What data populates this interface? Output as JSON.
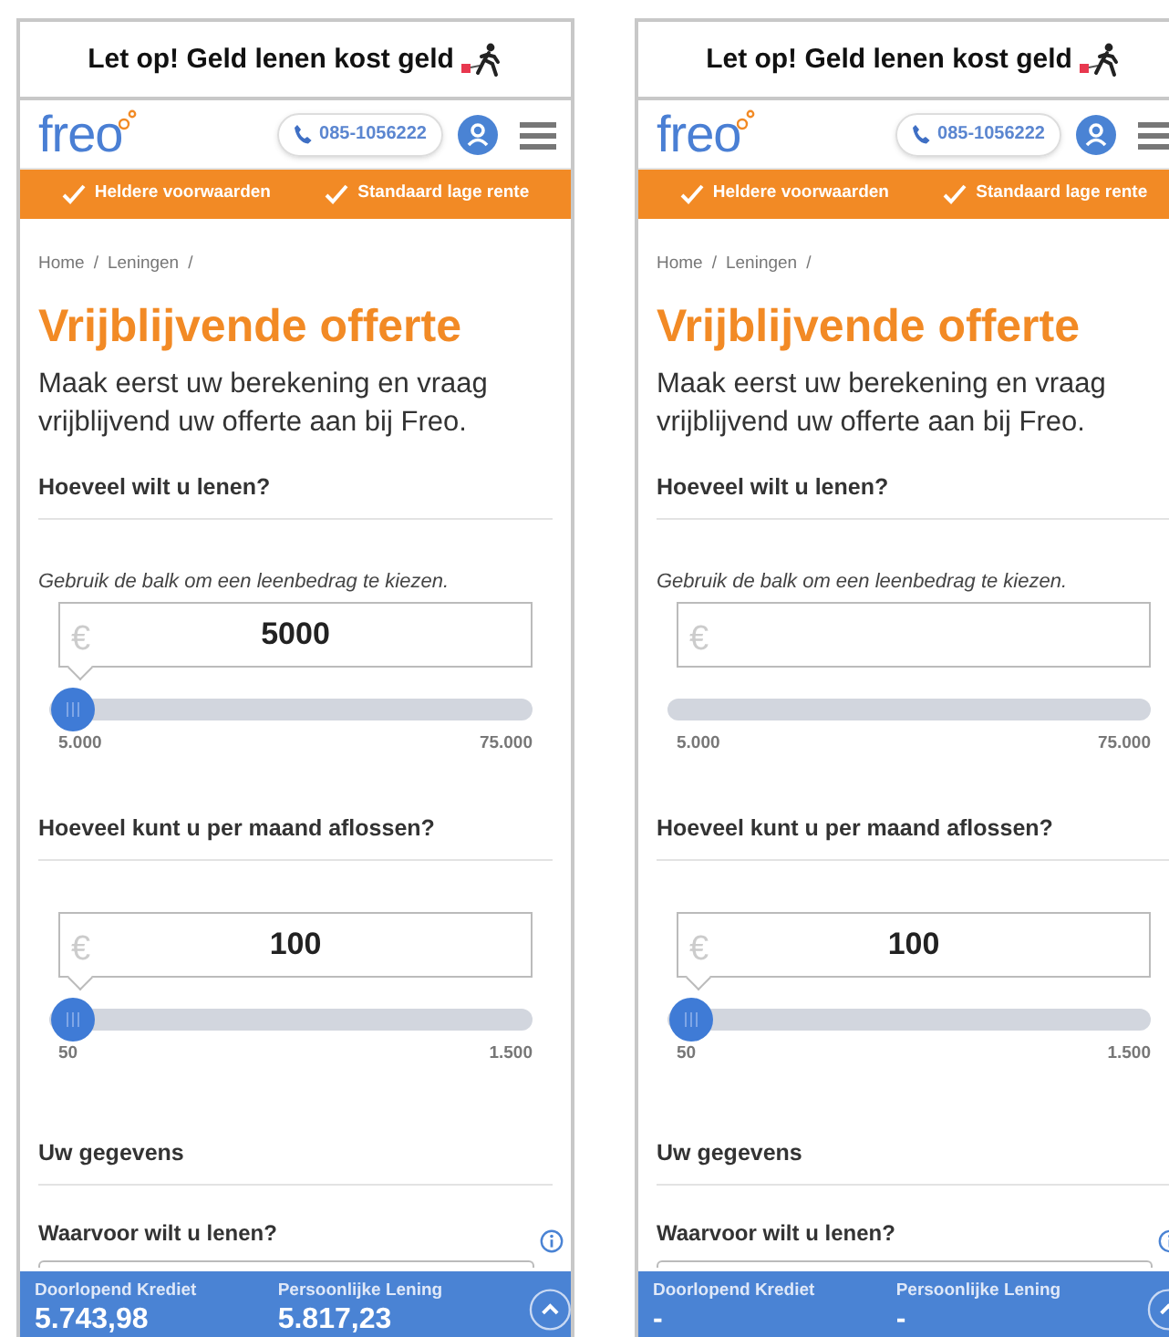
{
  "panels": [
    {
      "banner": "Let op! Geld lenen kost geld",
      "logo": "freo",
      "phone": "085-1056222",
      "usps": [
        "Heldere voorwaarden",
        "Standaard lage rente"
      ],
      "breadcrumb": [
        "Home",
        "Leningen"
      ],
      "separators": [
        "/",
        "/"
      ],
      "title": "Vrijblijvende offerte",
      "intro": "Maak eerst uw berekening en vraag vrijblijvend uw offerte aan bij Freo.",
      "sliders": [
        {
          "heading": "Hoeveel wilt u lenen?",
          "hint": "Gebruik de balk om een leenbedrag te kiezen.",
          "currency": "€",
          "value": "5000",
          "level": 0,
          "min": "5.000",
          "max": "75.000"
        },
        {
          "heading": "Hoeveel kunt u per maand aflossen?",
          "currency": "€",
          "value": "100",
          "level": 0,
          "min": "50",
          "max": "1.500"
        }
      ],
      "section": "Uw gegevens",
      "question": "Waarvoor wilt u lenen?",
      "results": [
        {
          "label": "Doorlopend Krediet",
          "value": "5.743,98"
        },
        {
          "label": "Persoonlijke Lening",
          "value": "5.817,23"
        }
      ]
    },
    {
      "banner": "Let op! Geld lenen kost geld",
      "logo": "freo",
      "phone": "085-1056222",
      "usps": [
        "Heldere voorwaarden",
        "Standaard lage rente"
      ],
      "breadcrumb": [
        "Home",
        "Leningen"
      ],
      "separators": [
        "/",
        "/"
      ],
      "title": "Vrijblijvende offerte",
      "intro": "Maak eerst uw berekening en vraag vrijblijvend uw offerte aan bij Freo.",
      "sliders": [
        {
          "heading": "Hoeveel wilt u lenen?",
          "hint": "Gebruik de balk om een leenbedrag te kiezen.",
          "currency": "€",
          "min": "5.000",
          "max": "75.000"
        },
        {
          "heading": "Hoeveel kunt u per maand aflossen?",
          "currency": "€",
          "value": "100",
          "level": 0,
          "min": "50",
          "max": "1.500"
        }
      ],
      "section": "Uw gegevens",
      "question": "Waarvoor wilt u lenen?",
      "results": [
        {
          "label": "Doorlopend Krediet",
          "value": "-"
        },
        {
          "label": "Persoonlijke Lening",
          "value": "-"
        }
      ]
    }
  ]
}
